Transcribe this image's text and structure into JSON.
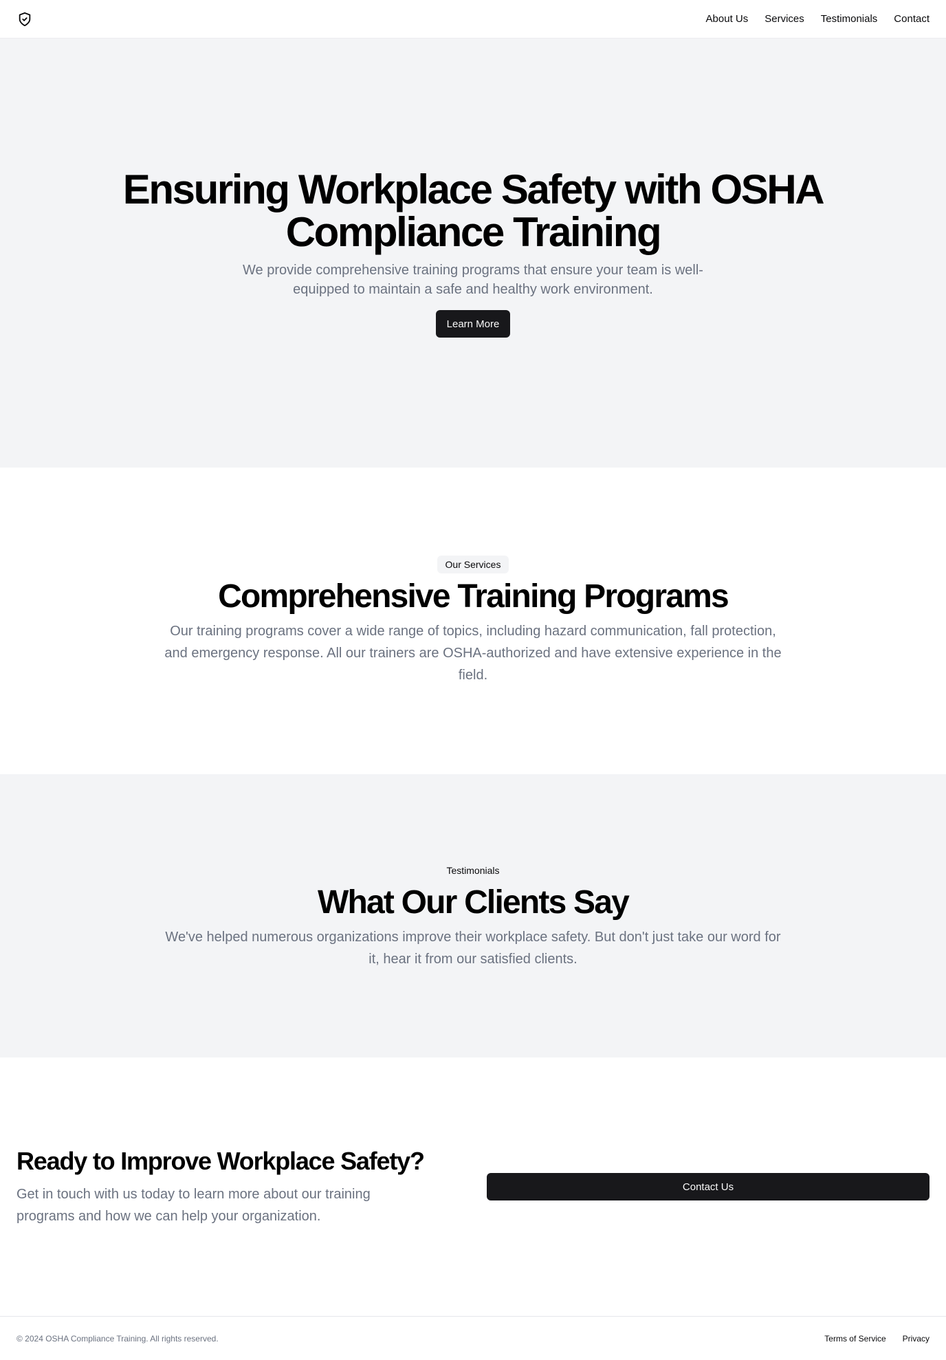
{
  "header": {
    "logo_icon": "shield-check-icon",
    "nav": [
      {
        "label": "About Us"
      },
      {
        "label": "Services"
      },
      {
        "label": "Testimonials"
      },
      {
        "label": "Contact"
      }
    ]
  },
  "hero": {
    "title": "Ensuring Workplace Safety with OSHA Compliance Training",
    "subtitle": "We provide comprehensive training programs that ensure your team is well-equipped to maintain a safe and healthy work environment.",
    "button_label": "Learn More"
  },
  "services": {
    "badge": "Our Services",
    "title": "Comprehensive Training Programs",
    "text": "Our training programs cover a wide range of topics, including hazard communication, fall protection, and emergency response. All our trainers are OSHA-authorized and have extensive experience in the field."
  },
  "testimonials": {
    "badge": "Testimonials",
    "title": "What Our Clients Say",
    "text": "We've helped numerous organizations improve their workplace safety. But don't just take our word for it, hear it from our satisfied clients."
  },
  "cta": {
    "title": "Ready to Improve Workplace Safety?",
    "text": "Get in touch with us today to learn more about our training programs and how we can help your organization.",
    "button_label": "Contact Us"
  },
  "footer": {
    "copyright": "© 2024 OSHA Compliance Training. All rights reserved.",
    "links": [
      {
        "label": "Terms of Service"
      },
      {
        "label": "Privacy"
      }
    ]
  },
  "colors": {
    "primary": "#18181b",
    "muted_text": "#6b7280",
    "section_bg": "#f3f4f6"
  }
}
